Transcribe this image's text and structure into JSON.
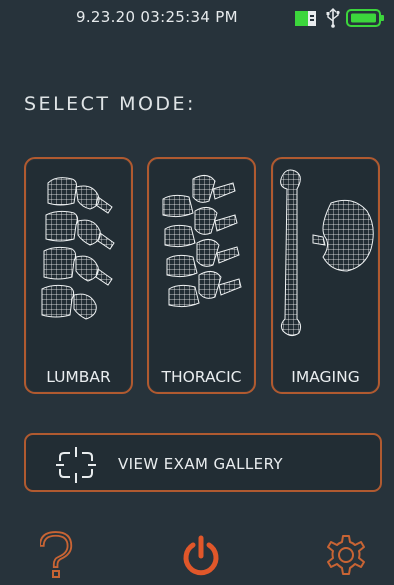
{
  "status": {
    "datetime": "9.23.20  03:25:34 PM",
    "icons": [
      "sd-card-icon",
      "usb-icon",
      "battery-icon"
    ]
  },
  "title": "SELECT MODE:",
  "modes": [
    {
      "label": "LUMBAR",
      "icon": "lumbar-spine-icon"
    },
    {
      "label": "THORACIC",
      "icon": "thoracic-spine-icon"
    },
    {
      "label": "IMAGING",
      "icon": "bone-kidney-icon"
    }
  ],
  "gallery": {
    "label": "VIEW EXAM GALLERY",
    "icon": "camera-frame-icon"
  },
  "bottom": {
    "icons": [
      "help-icon",
      "power-icon",
      "settings-icon"
    ]
  },
  "colors": {
    "background": "#27333b",
    "accent": "#b05a30",
    "power": "#e0572a",
    "battery": "#3cd63c"
  }
}
